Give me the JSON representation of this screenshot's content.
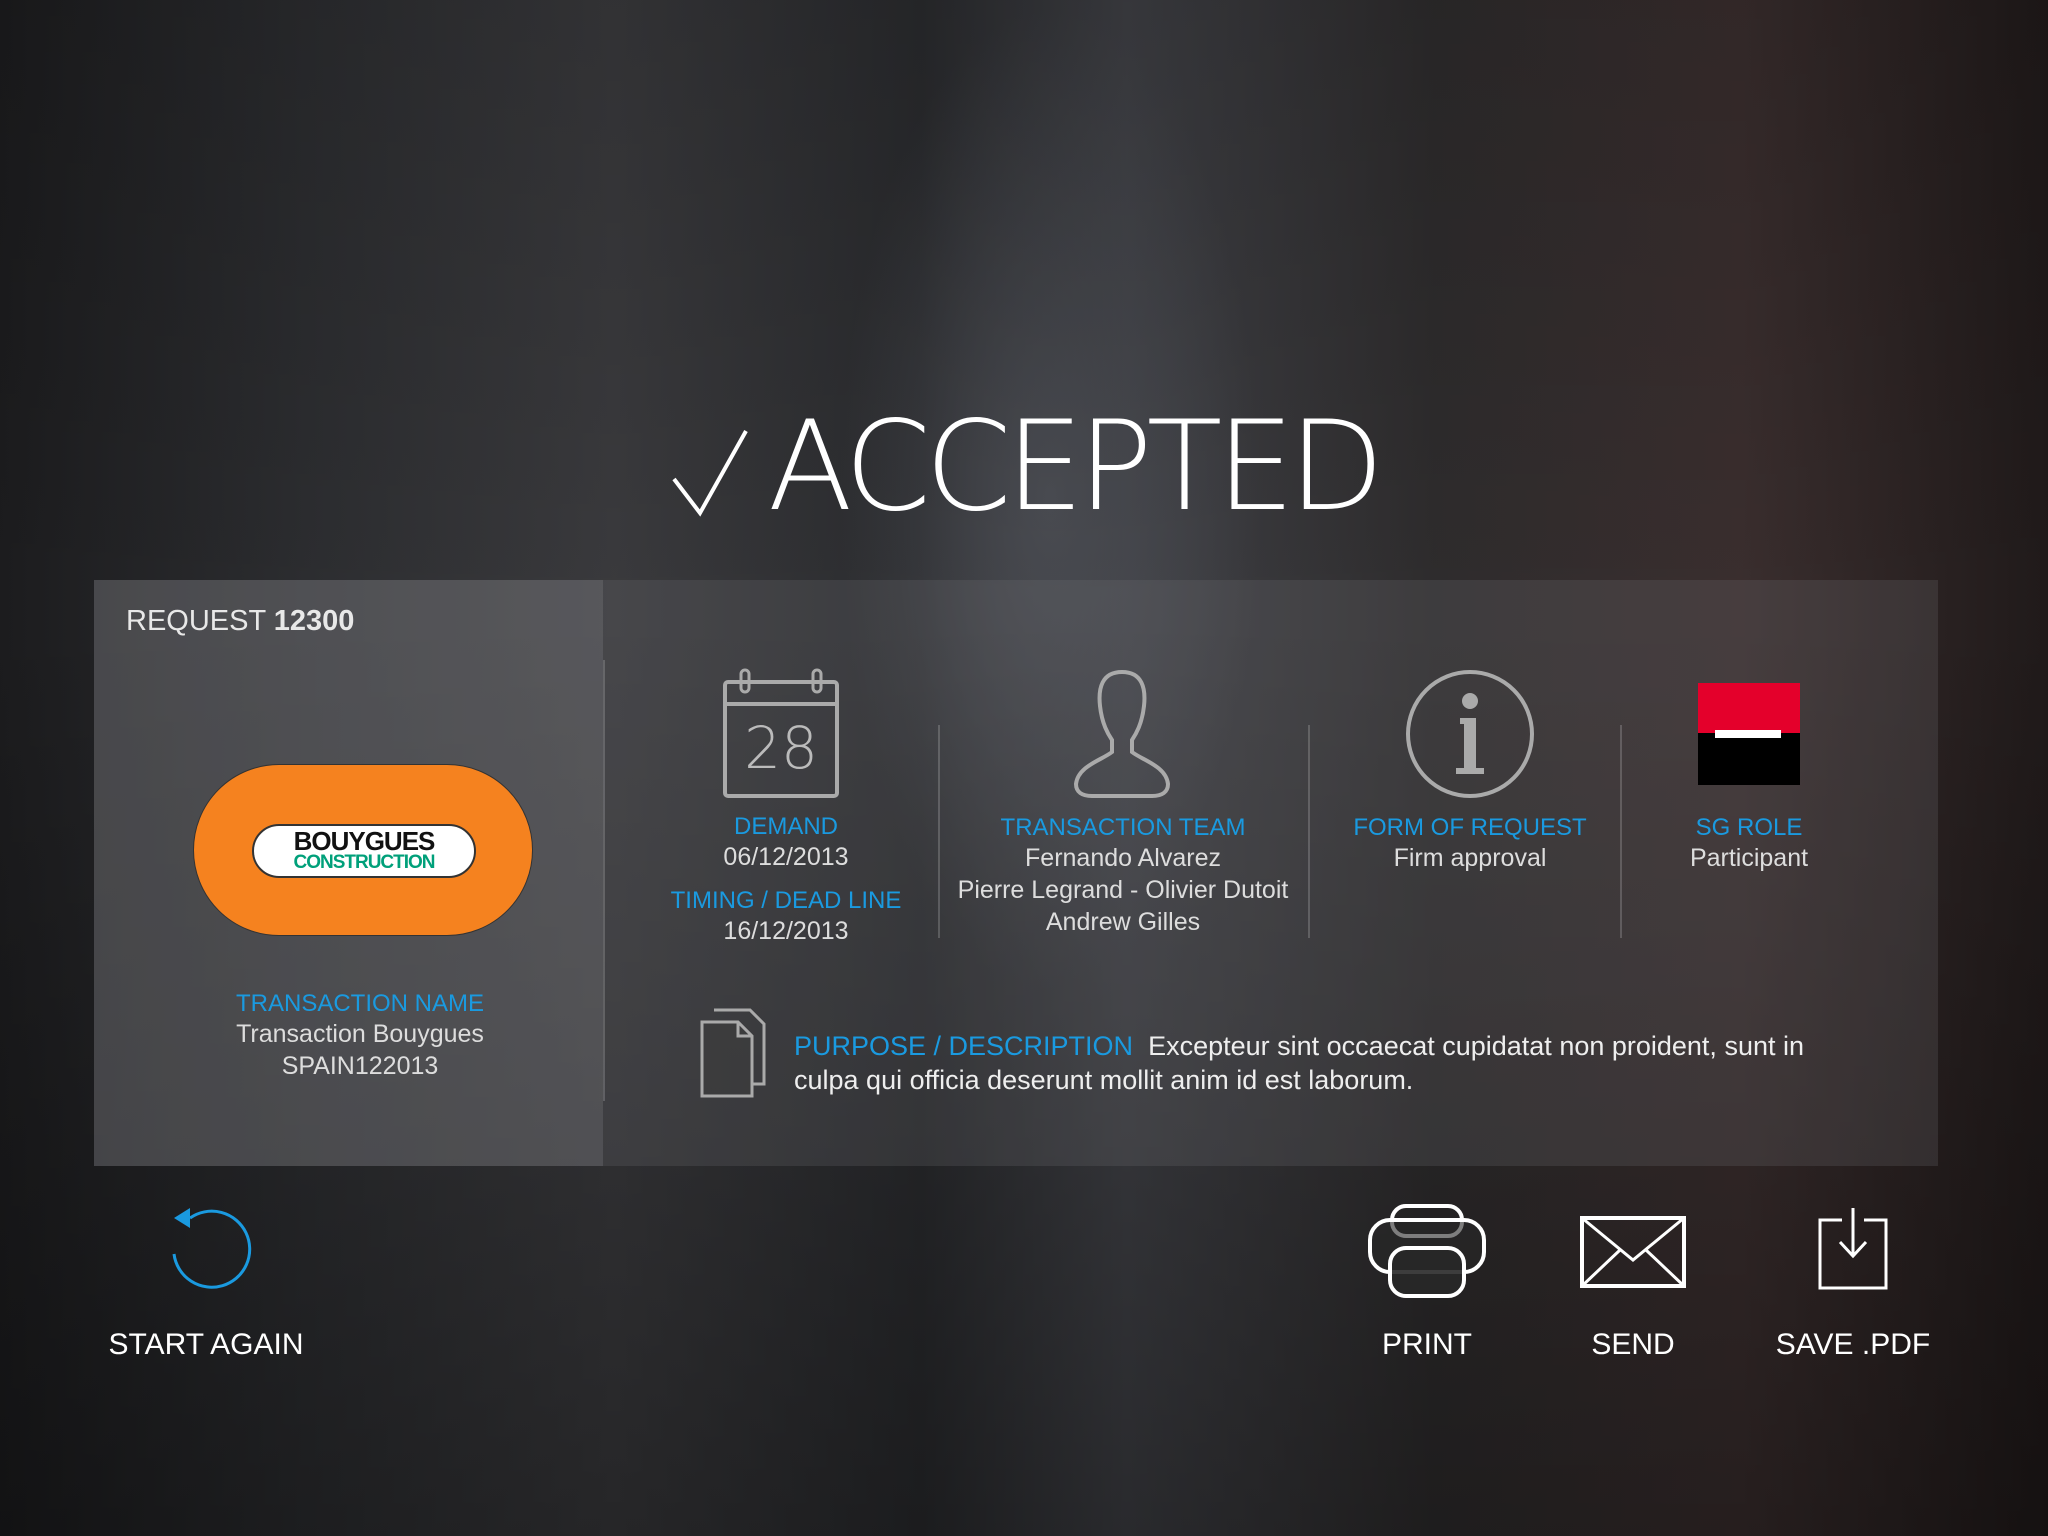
{
  "status": {
    "title": "ACCEPTED",
    "icon": "check-icon"
  },
  "request": {
    "label": "REQUEST",
    "number": "12300"
  },
  "client": {
    "logo_line1": "BOUYGUES",
    "logo_line2": "CONSTRUCTION",
    "logo_color": "#f5821f",
    "logo_green": "#00a07a"
  },
  "transaction": {
    "label": "TRANSACTION NAME",
    "name": "Transaction Bouygues",
    "code": "SPAIN122013"
  },
  "calendar": {
    "day": "28",
    "demand_label": "DEMAND",
    "demand_date": "06/12/2013",
    "timing_label": "TIMING / DEAD LINE",
    "timing_date": "16/12/2013"
  },
  "team": {
    "label": "TRANSACTION TEAM",
    "members": [
      "Fernando Alvarez",
      "Pierre Legrand - Olivier Dutoit",
      "Andrew Gilles"
    ]
  },
  "form": {
    "label": "FORM OF REQUEST",
    "value": "Firm approval"
  },
  "sg": {
    "label": "SG ROLE",
    "value": "Participant",
    "red": "#e4002b"
  },
  "purpose": {
    "label": "PURPOSE / DESCRIPTION",
    "line1": "Excepteur sint occaecat cupidatat non proident, sunt in",
    "line2": "culpa qui officia deserunt mollit anim id est laborum."
  },
  "actions": {
    "start_again": "START AGAIN",
    "print": "PRINT",
    "send": "SEND",
    "save_pdf": "SAVE .PDF"
  },
  "colors": {
    "accent": "#1a9ae0"
  }
}
